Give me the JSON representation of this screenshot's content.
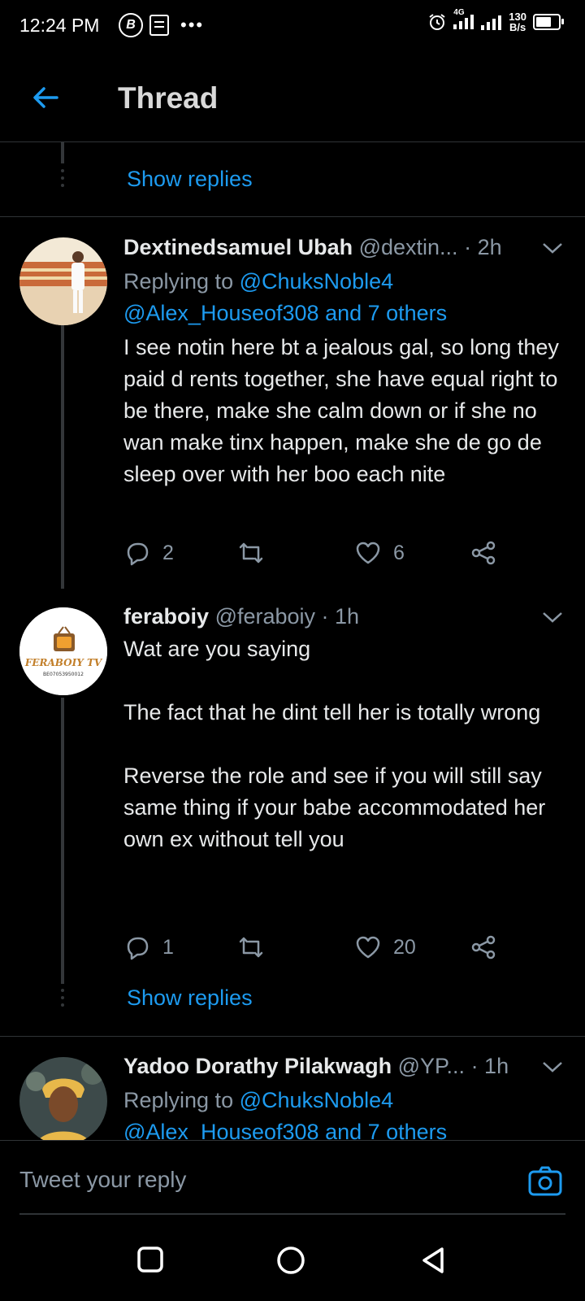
{
  "status_bar": {
    "time": "12:24 PM",
    "network": "4G",
    "speed_value": "130",
    "speed_unit": "B/s"
  },
  "header": {
    "title": "Thread"
  },
  "show_replies_label": "Show replies",
  "tweets": [
    {
      "name": "Dextinedsamuel Ubah",
      "handle": "@dextin...",
      "time": "· 2h",
      "replying_prefix": "Replying to",
      "replying_line1": "@ChuksNoble4",
      "replying_line2": "@Alex_Houseof308 and 7 others",
      "text": "I see notin here bt a jealous gal, so long they paid d rents together, she have equal right to be there, make she calm down or if she no wan make tinx happen, make she de go de sleep over with her boo each nite",
      "replies": "2",
      "retweets": "",
      "likes": "6"
    },
    {
      "name": "feraboiy",
      "handle": "@feraboiy",
      "time": "· 1h",
      "text": "Wat are you saying\n\nThe fact that he dint tell her is totally wrong\n\nReverse the role and see if you will still say same thing if your babe accommodated her own ex without tell you",
      "replies": "1",
      "retweets": "",
      "likes": "20",
      "avatar_text": "FERABOIY TV",
      "avatar_sub": "BE07053950012"
    },
    {
      "name": "Yadoo Dorathy Pilakwagh",
      "handle": "@YP...",
      "time": "· 1h",
      "replying_prefix": "Replying to",
      "replying_line1": "@ChuksNoble4",
      "replying_line2": "@Alex_Houseof308 and 7 others"
    }
  ],
  "reply_bar": {
    "placeholder": "Tweet your reply"
  },
  "colors": {
    "accent": "#1d9bf0",
    "muted": "#8b98a5",
    "background": "#000000"
  }
}
